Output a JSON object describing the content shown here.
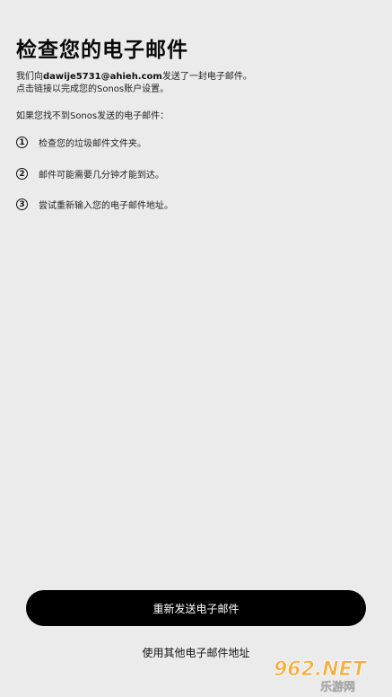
{
  "title": "检查您的电子邮件",
  "intro": {
    "prefix": "我们向",
    "email": "dawije5731@ahieh.com",
    "suffix": "发送了一封电子邮件。",
    "line2": "点击链接以完成您的Sonos账户设置。"
  },
  "not_found": "如果您找不到Sonos发送的电子邮件：",
  "steps": [
    {
      "num": "1",
      "text": "检查您的垃圾邮件文件夹。"
    },
    {
      "num": "2",
      "text": "邮件可能需要几分钟才能到达。"
    },
    {
      "num": "3",
      "text": "尝试重新输入您的电子邮件地址。"
    }
  ],
  "resend_button": "重新发送电子邮件",
  "other_email_link": "使用其他电子邮件地址",
  "watermark": {
    "brand": "962.NET",
    "sub": "乐游网"
  }
}
